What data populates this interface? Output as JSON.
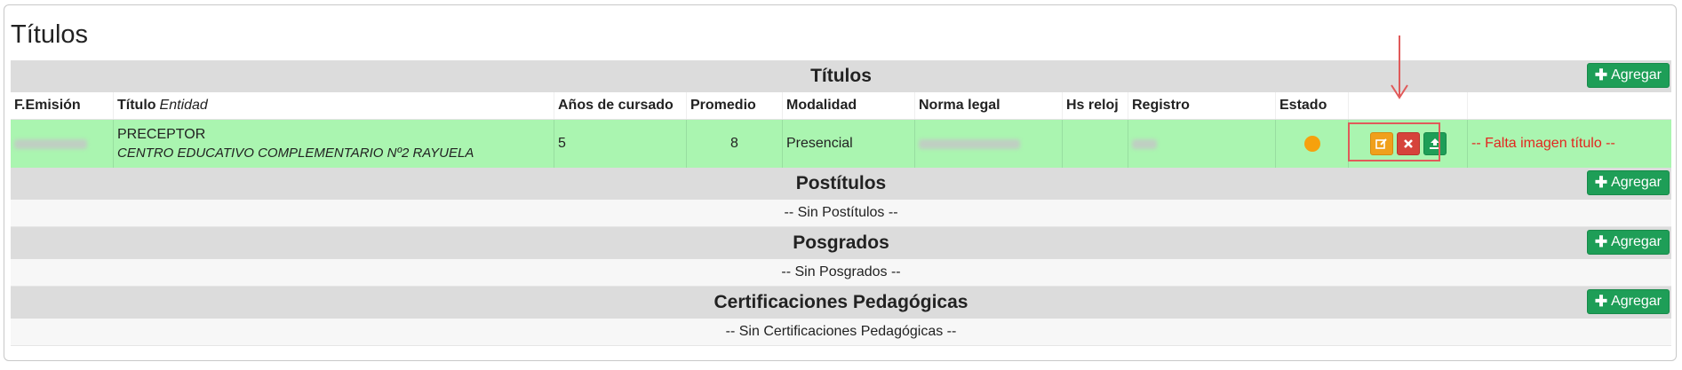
{
  "page_title": "Títulos",
  "add_label": "Agregar",
  "sections": {
    "titulos": {
      "title": "Títulos"
    },
    "postitulos": {
      "title": "Postítulos",
      "empty": "-- Sin Postítulos --"
    },
    "posgrados": {
      "title": "Posgrados",
      "empty": "-- Sin Posgrados --"
    },
    "certificaciones": {
      "title": "Certificaciones Pedagógicas",
      "empty": "-- Sin Certificaciones Pedagógicas --"
    }
  },
  "columns": {
    "f_emision": "F.Emisión",
    "titulo": "Título",
    "entidad": "Entidad",
    "anios": "Años de cursado",
    "promedio": "Promedio",
    "modalidad": "Modalidad",
    "norma": "Norma legal",
    "hs_reloj": "Hs reloj",
    "registro": "Registro",
    "estado": "Estado"
  },
  "row": {
    "titulo": "PRECEPTOR",
    "entidad": "CENTRO EDUCATIVO COMPLEMENTARIO Nº2 RAYUELA",
    "anios": "5",
    "promedio": "8",
    "modalidad": "Presencial",
    "hs_reloj": "",
    "warning": "-- Falta imagen título --",
    "status_color": "#f6a10d"
  },
  "icons": {
    "add": "plus-icon",
    "edit": "edit-icon",
    "delete": "close-icon",
    "upload": "upload-icon"
  },
  "colors": {
    "row_bg": "#aaf5b0",
    "header_bg": "#dcdcdc",
    "add_button": "#1e9e57",
    "edit_button": "#f0a01c",
    "delete_button": "#d6433b",
    "annotation": "#e05a5a"
  }
}
